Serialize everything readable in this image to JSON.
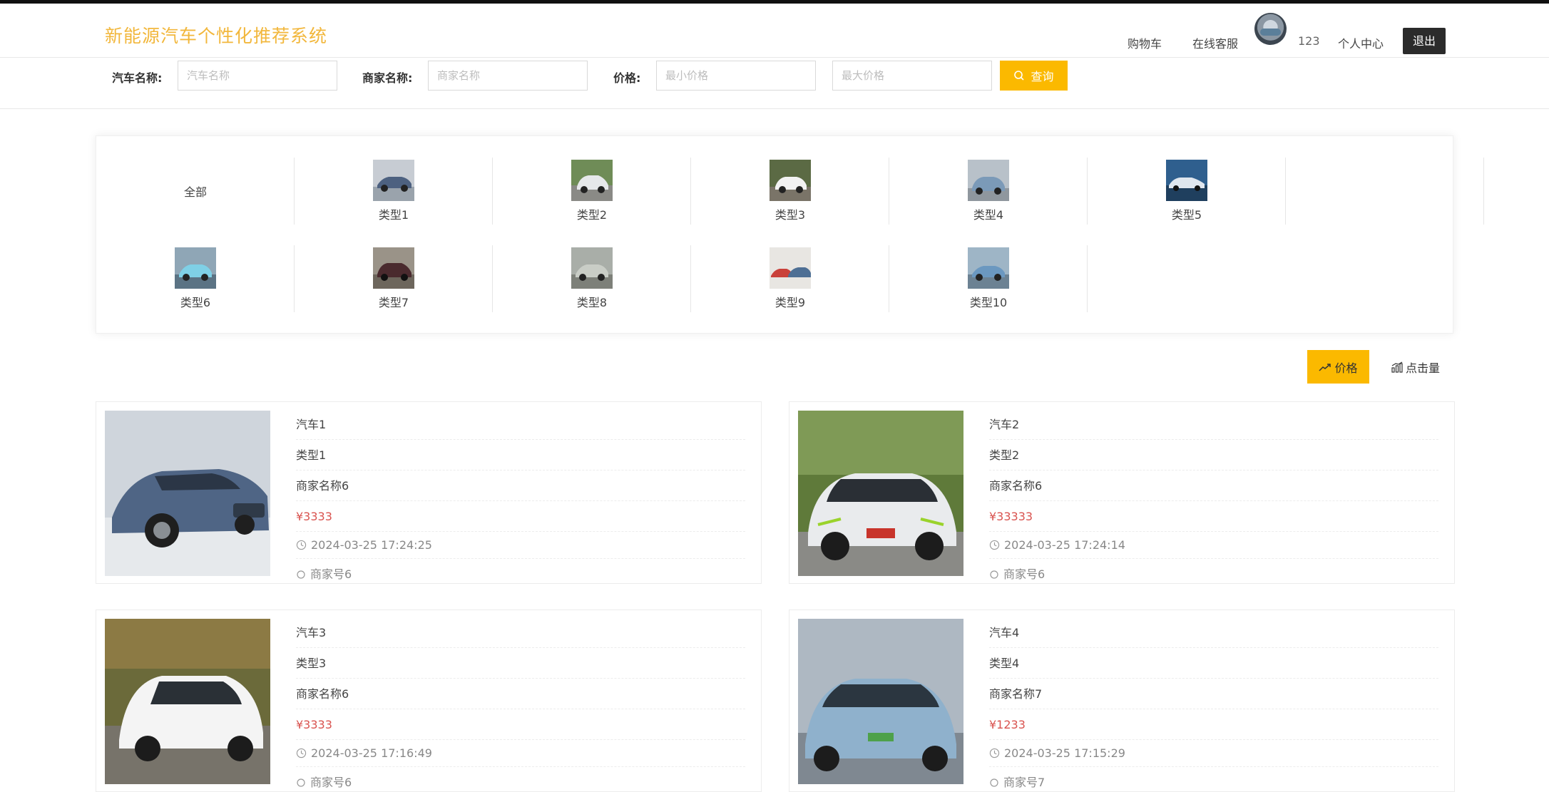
{
  "header": {
    "title": "新能源汽车个性化推荐系统",
    "nav": {
      "cart": "购物车",
      "service": "在线客服",
      "username": "123",
      "profile": "个人中心",
      "logout": "退出"
    }
  },
  "search": {
    "car_name_label": "汽车名称:",
    "car_name_placeholder": "汽车名称",
    "merchant_label": "商家名称:",
    "merchant_placeholder": "商家名称",
    "price_label": "价格:",
    "min_price_placeholder": "最小价格",
    "max_price_placeholder": "最大价格",
    "search_button": "查询"
  },
  "categories": {
    "all": "全部",
    "items": [
      "类型1",
      "类型2",
      "类型3",
      "类型4",
      "类型5",
      "类型6",
      "类型7",
      "类型8",
      "类型9",
      "类型10"
    ]
  },
  "sort": {
    "price": "价格",
    "clicks": "点击量"
  },
  "cars": [
    {
      "name": "汽车1",
      "type": "类型1",
      "merchant": "商家名称6",
      "price": "¥3333",
      "time": "2024-03-25 17:24:25",
      "merchant_account": "商家号6"
    },
    {
      "name": "汽车2",
      "type": "类型2",
      "merchant": "商家名称6",
      "price": "¥33333",
      "time": "2024-03-25 17:24:14",
      "merchant_account": "商家号6"
    },
    {
      "name": "汽车3",
      "type": "类型3",
      "merchant": "商家名称6",
      "price": "¥3333",
      "time": "2024-03-25 17:16:49",
      "merchant_account": "商家号6"
    },
    {
      "name": "汽车4",
      "type": "类型4",
      "merchant": "商家名称7",
      "price": "¥1233",
      "time": "2024-03-25 17:15:29",
      "merchant_account": "商家号7"
    }
  ],
  "colors": {
    "accent": "#fbb900",
    "title": "#f2b73c",
    "price": "#d9534f"
  }
}
